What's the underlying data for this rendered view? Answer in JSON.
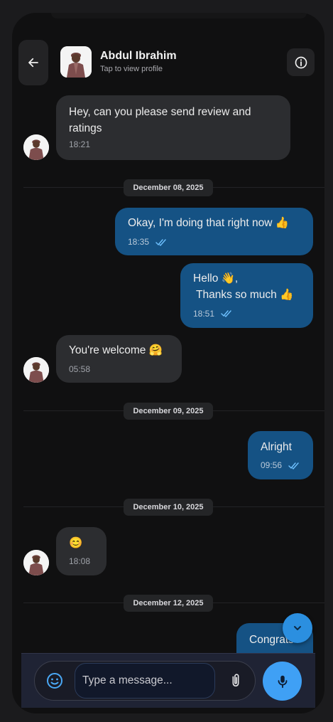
{
  "header": {
    "name": "Abdul Ibrahim",
    "subtitle": "Tap to view profile"
  },
  "messages": [
    {
      "direction": "in",
      "text": "Hey, can you please send review and\nratings",
      "time": "18:21"
    },
    {
      "direction": "out",
      "text": "Okay, I'm doing that right now 👍",
      "time": "18:35",
      "read": true
    },
    {
      "direction": "out",
      "text": "Hello 👋,\n Thanks so much 👍",
      "time": "18:51",
      "read": true
    },
    {
      "direction": "in",
      "text": "You're welcome 🤗",
      "time": "05:58"
    },
    {
      "direction": "out",
      "text": "Alright",
      "time": "09:56",
      "read": true
    },
    {
      "direction": "in",
      "text": "😊",
      "time": "18:08"
    },
    {
      "direction": "out",
      "text": "Congrats",
      "time": ""
    }
  ],
  "dates": [
    "December 08, 2025",
    "December 09, 2025",
    "December 10, 2025",
    "December 12, 2025"
  ],
  "composer": {
    "placeholder": "Type a message..."
  },
  "colors": {
    "incoming_bubble": "#2c2d30",
    "outgoing_bubble": "#155284",
    "accent": "#3fa0f5"
  },
  "icons": [
    "back-arrow-icon",
    "info-icon",
    "double-check-icon",
    "chevron-down-icon",
    "emoji-icon",
    "paperclip-icon",
    "microphone-icon"
  ]
}
